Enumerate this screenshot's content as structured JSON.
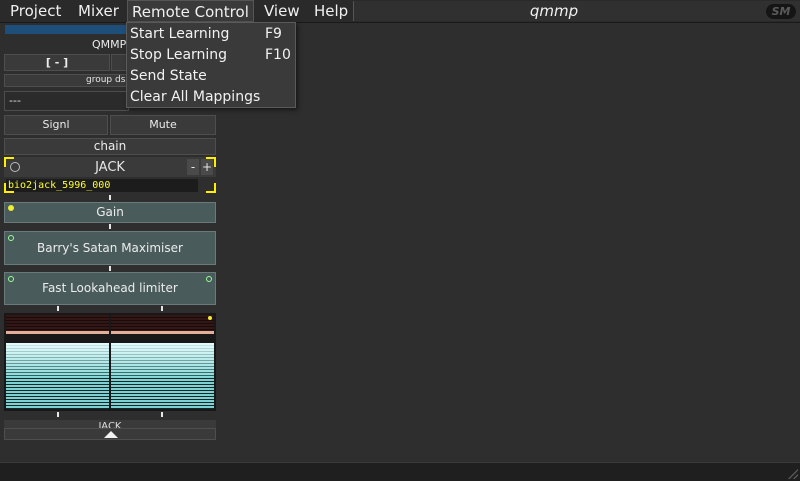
{
  "menubar": {
    "items": [
      "Project",
      "Mixer",
      "Remote Control",
      "View",
      "Help"
    ],
    "title": "qmmp",
    "badge": "SM"
  },
  "remote_menu": {
    "items": [
      {
        "label": "Start Learning",
        "shortcut": "F9"
      },
      {
        "label": "Stop Learning",
        "shortcut": "F10"
      },
      {
        "label": "Send State",
        "shortcut": ""
      },
      {
        "label": "Clear All Mappings",
        "shortcut": ""
      }
    ]
  },
  "strip": {
    "name": "QMMP",
    "collapse_button": "[ - ]",
    "group_label": "group ds",
    "output_value": "---",
    "signal_button": "Signl",
    "mute_button": "Mute",
    "chain_label": "chain",
    "input_module": {
      "label": "JACK",
      "minus": "-",
      "plus": "+",
      "client": "bio2jack_5996_000"
    },
    "modules": [
      "Gain",
      "Barry's Satan Maximiser",
      "Fast Lookahead limiter"
    ],
    "output_label": "JACK"
  },
  "colors": {
    "accent_yellow": "#ffee00",
    "module_bg": "#4a5b5b",
    "meter": "#7fd0d0"
  }
}
